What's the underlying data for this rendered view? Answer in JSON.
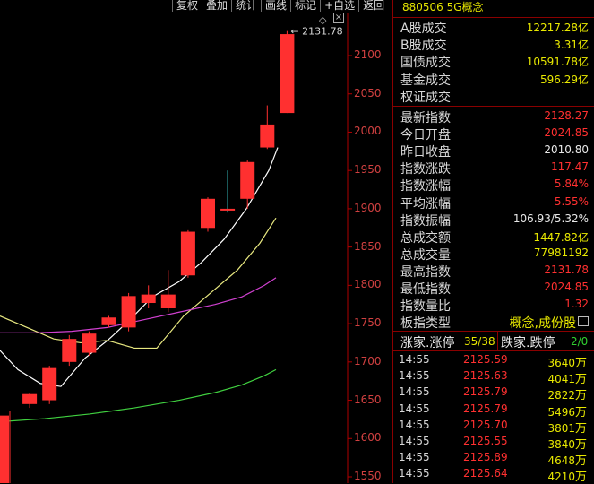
{
  "toolbar": [
    "复权",
    "叠加",
    "统计",
    "画线",
    "标记",
    "+自选",
    "返回"
  ],
  "chart": {
    "y_ticks": [
      "2100",
      "2050",
      "2000",
      "1950",
      "1900",
      "1850",
      "1800",
      "1750",
      "1700",
      "1650",
      "1600",
      "1550"
    ],
    "high_label": "2131.78",
    "candles": [
      {
        "o": 1630,
        "c": 1540,
        "h": 1636,
        "l": 1540
      },
      {
        "o": 1645,
        "c": 1658,
        "h": 1660,
        "l": 1640
      },
      {
        "o": 1650,
        "c": 1692,
        "h": 1695,
        "l": 1645
      },
      {
        "o": 1700,
        "c": 1730,
        "h": 1735,
        "l": 1695
      },
      {
        "o": 1712,
        "c": 1737,
        "h": 1740,
        "l": 1708
      },
      {
        "o": 1748,
        "c": 1758,
        "h": 1760,
        "l": 1745
      },
      {
        "o": 1745,
        "c": 1786,
        "h": 1790,
        "l": 1740
      },
      {
        "o": 1777,
        "c": 1788,
        "h": 1800,
        "l": 1770
      },
      {
        "o": 1770,
        "c": 1788,
        "h": 1820,
        "l": 1765
      },
      {
        "o": 1813,
        "c": 1870,
        "h": 1872,
        "l": 1810
      },
      {
        "o": 1875,
        "c": 1913,
        "h": 1915,
        "l": 1870
      },
      {
        "o": 1900,
        "c": 1900,
        "h": 1950,
        "l": 1895
      },
      {
        "o": 1913,
        "c": 1961,
        "h": 1963,
        "l": 1900
      },
      {
        "o": 1980,
        "c": 2010,
        "h": 2035,
        "l": 1978
      },
      {
        "o": 2025,
        "c": 2128,
        "h": 2132,
        "l": 2025
      }
    ]
  },
  "panel": {
    "title": "880506 5G概念",
    "summary": [
      {
        "label": "A股成交",
        "value": "12217.28亿",
        "color": "yellow"
      },
      {
        "label": "B股成交",
        "value": "3.31亿",
        "color": "yellow"
      },
      {
        "label": "国债成交",
        "value": "10591.78亿",
        "color": "yellow"
      },
      {
        "label": "基金成交",
        "value": "596.29亿",
        "color": "yellow"
      },
      {
        "label": "权证成交",
        "value": "",
        "color": "yellow"
      }
    ],
    "stats": [
      {
        "label": "最新指数",
        "value": "2128.27",
        "color": "red"
      },
      {
        "label": "今日开盘",
        "value": "2024.85",
        "color": "red"
      },
      {
        "label": "昨日收盘",
        "value": "2010.80",
        "color": "white"
      },
      {
        "label": "指数涨跌",
        "value": "117.47",
        "color": "red"
      },
      {
        "label": "指数涨幅",
        "value": "5.84%",
        "color": "red"
      },
      {
        "label": "平均涨幅",
        "value": "5.55%",
        "color": "red"
      },
      {
        "label": "指数振幅",
        "value": "106.93/5.32%",
        "color": "white"
      },
      {
        "label": "总成交额",
        "value": "1447.82亿",
        "color": "yellow"
      },
      {
        "label": "总成交量",
        "value": "77981192",
        "color": "yellow"
      },
      {
        "label": "最高指数",
        "value": "2131.78",
        "color": "red"
      },
      {
        "label": "最低指数",
        "value": "2024.85",
        "color": "red"
      },
      {
        "label": "指数量比",
        "value": "1.32",
        "color": "red"
      },
      {
        "label": "板指类型",
        "value": "概念,成份股",
        "color": "yellow"
      }
    ],
    "breadth": {
      "up_label": "涨家.涨停",
      "up_value": "35/38",
      "down_label": "跌家.跌停",
      "down_value": "2/0"
    },
    "trades": [
      {
        "time": "14:55",
        "price": "2125.59",
        "vol": "3640",
        "unit": "万"
      },
      {
        "time": "14:55",
        "price": "2125.63",
        "vol": "4041",
        "unit": "万"
      },
      {
        "time": "14:55",
        "price": "2125.79",
        "vol": "2822",
        "unit": "万"
      },
      {
        "time": "14:55",
        "price": "2125.79",
        "vol": "5496",
        "unit": "万"
      },
      {
        "time": "14:55",
        "price": "2125.70",
        "vol": "3801",
        "unit": "万"
      },
      {
        "time": "14:55",
        "price": "2125.55",
        "vol": "3840",
        "unit": "万"
      },
      {
        "time": "14:55",
        "price": "2125.89",
        "vol": "4648",
        "unit": "万"
      },
      {
        "time": "14:55",
        "price": "2125.64",
        "vol": "4210",
        "unit": "万"
      }
    ]
  }
}
